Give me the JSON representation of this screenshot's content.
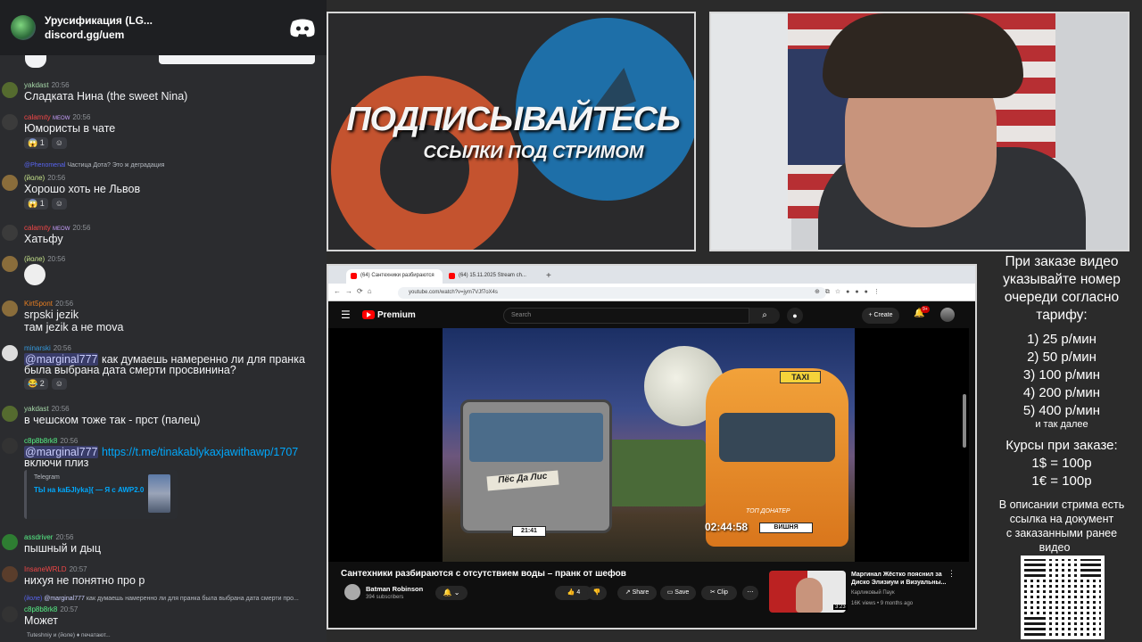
{
  "chat": {
    "server_name": "Урусификация (LG...",
    "server_invite": "discord.gg/uem",
    "messages": [
      {
        "user": "yakdast",
        "time": "20:56",
        "user_color": "#a5d6a7",
        "text": "Сладката Нина (the sweet Nina)"
      },
      {
        "user": "calamıty",
        "badge": "MEOW",
        "time": "20:56",
        "user_color": "#f04747",
        "text": "Юмористы в чате",
        "reaction_count": "1"
      },
      {
        "reply_user": "@Phenomenal",
        "reply_text": "Частица Дота? Это ж деградация",
        "user": "(йоле)",
        "time": "20:56",
        "user_color": "#c6e48b",
        "text": "Хорошо хоть не Львов",
        "reaction_count": "1"
      },
      {
        "user": "calamıty",
        "badge": "MEOW",
        "time": "20:56",
        "user_color": "#f04747",
        "text": "Хатьфу"
      },
      {
        "user": "(йоле)",
        "time": "20:56",
        "user_color": "#c6e48b"
      },
      {
        "user": "Kirt5pont",
        "time": "20:56",
        "user_color": "#e67e22",
        "text": "srpski jezik",
        "text2": "там jezik а не mova"
      },
      {
        "user": "minarski",
        "time": "20:56",
        "user_color": "#3498db",
        "mention": "@marginal777",
        "text": " как думаешь намеренно ли для пранка",
        "text2": "была выбрана дата смерти просвинина?",
        "reaction_count": "2"
      },
      {
        "user": "yakdast",
        "time": "20:56",
        "user_color": "#a5d6a7",
        "text": "в чешском тоже так - прст (палец)"
      },
      {
        "user": "c8p8b8rk8",
        "time": "20:56",
        "user_color": "#57f287",
        "mention": "@marginal777",
        "link": "https://t.me/tinakablykaxjawithawp/1707",
        "text2": "включи плиз"
      },
      {
        "user": "assdriver",
        "time": "20:56",
        "user_color": "#57f287",
        "text": "пышный и дыц"
      },
      {
        "user": "InsaneWRLD",
        "time": "20:57",
        "user_color": "#f04747",
        "text": "нихуя не понятно про р"
      },
      {
        "reply_user": "(йоле)",
        "reply_mention": "@marginal777",
        "reply_text": " как думаешь намеренно ли для пранка была выбрана дата смерти про...",
        "user": "c8p8b8rk8",
        "time": "20:57",
        "user_color": "#57f287",
        "text": "Может"
      }
    ],
    "embed": {
      "site": "Telegram",
      "title": "ТЫ на kaБJIyka]{ — Я с AWP2.0"
    },
    "typing": "Tuteshniy и (йоле) ♦ печатают..."
  },
  "banner": {
    "title": "ПОДПИСЫВАЙТЕСЬ",
    "subtitle": "ССЫЛКИ ПОД СТРИМОМ"
  },
  "browser": {
    "tabs": [
      {
        "label": "(64) Сантехники разбираются"
      },
      {
        "label": "(64) 15.11.2025 Stream ch..."
      }
    ],
    "url": "youtube.com/watch?v=jym7VJf7oX4s",
    "yt": {
      "premium": "Premium",
      "search_placeholder": "Search",
      "create": "+ Create",
      "notif_count": "9+"
    },
    "video": {
      "taxi_sign": "TAXI",
      "van_plate": "ВИШНЯ",
      "truck_sign": "Пёс Да Лис",
      "truck_plate": "21:41",
      "timer": "02:44:58",
      "top_donater": "ТОП ДОНАТЕР"
    },
    "title": "Сантехники разбираются с отсутствием воды – пранк от шефов",
    "channel": "Batman Robinson",
    "subs": "394 subscribers",
    "like_count": "4",
    "share": "Share",
    "save": "Save",
    "clip": "Clip",
    "rec": {
      "title": "Маргинал Жёстко пояснил за Диско Элизиум и Визуальны...",
      "channel": "Карликовый Паук",
      "meta": "16K views • 9 months ago",
      "duration": "3:23"
    }
  },
  "panel": {
    "lines": [
      "При заказе видео",
      "указывайте номер",
      "очереди согласно",
      "тарифу:",
      "1) 25 р/мин",
      "2) 50 р/мин",
      "3) 100 р/мин",
      "4) 200 р/мин",
      "5) 400 р/мин",
      "и так далее",
      "Курсы при заказе:",
      "1$ = 100р",
      "1€ = 100р",
      "В описании стрима есть",
      "ссылка на документ",
      "с заказанными ранее",
      "видео"
    ]
  },
  "colors": {
    "discord_blurple": "#5865f2",
    "youtube_red": "#ff0000",
    "telegram_blue": "#1e6fa8",
    "banner_orange": "#c4532f"
  }
}
